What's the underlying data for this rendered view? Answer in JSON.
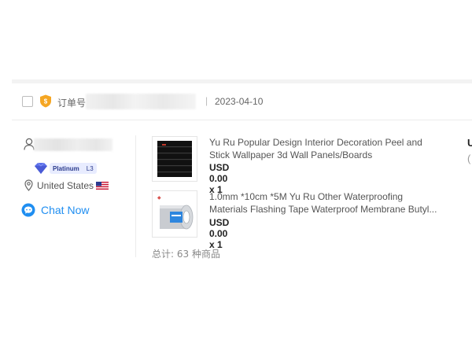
{
  "order": {
    "label": "订单号",
    "separator": "|",
    "date": "2023-04-10"
  },
  "seller": {
    "level_name": "Platinum",
    "level_code": "L3",
    "country": "United States",
    "chat_label": "Chat Now"
  },
  "products": [
    {
      "title_line1": "Yu Ru Popular Design Interior Decoration Peel and",
      "title_line2": "Stick Wallpaper 3d Wall Panels/Boards",
      "price": "USD 0.00 x 1"
    },
    {
      "title_line1": "1.0mm *10cm *5M Yu Ru Other Waterproofing",
      "title_line2": "Materials Flashing Tape Waterproof Membrane Butyl...",
      "price": "USD 0.00 x 1"
    }
  ],
  "summary": "总计: 63 种商品",
  "right_column": {
    "line1": "U",
    "line2": "("
  },
  "colors": {
    "accent": "#1f8ef1",
    "badge_bg": "#e8ecff",
    "order_icon": "#f5a623"
  }
}
